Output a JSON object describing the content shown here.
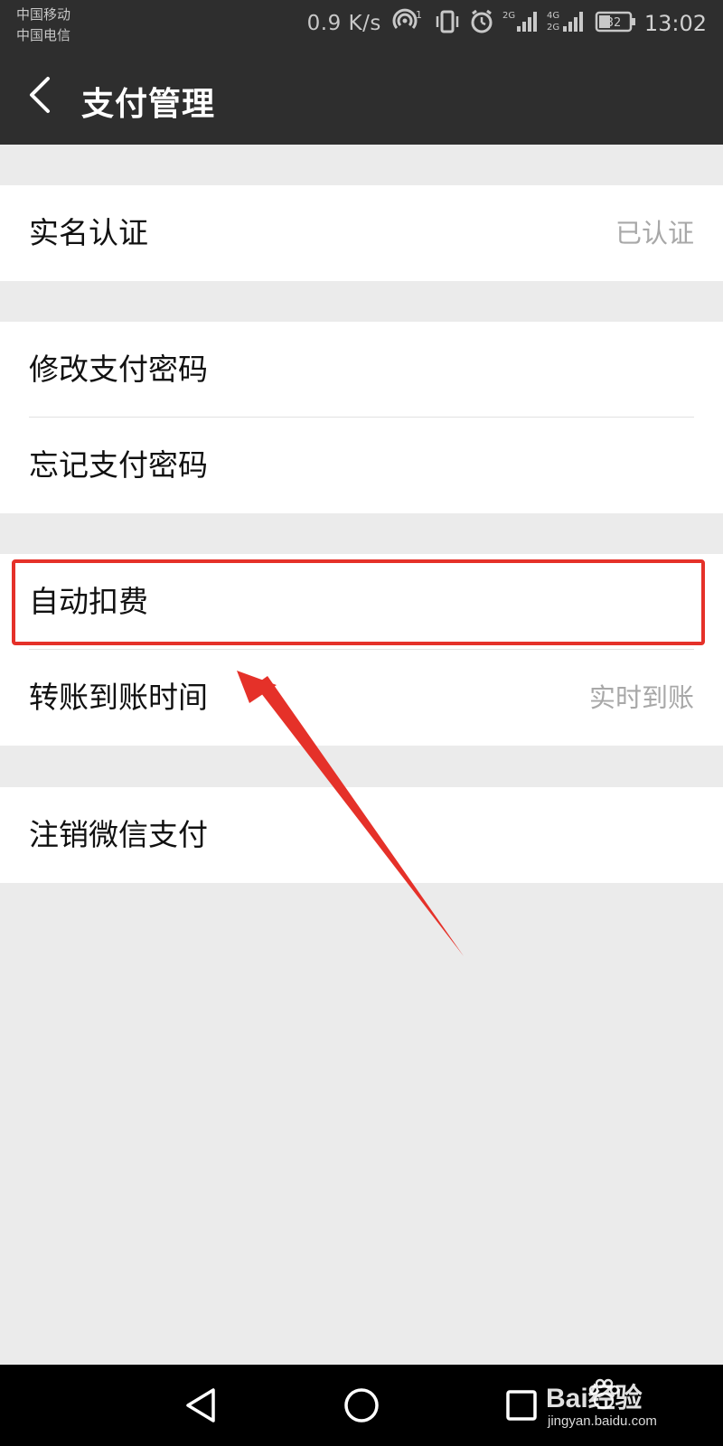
{
  "status_bar": {
    "carrier_1": "中国移动",
    "carrier_2": "中国电信",
    "net_speed": "0.9 K/s",
    "hotspot_badge": "1",
    "signal_label_1": "2G",
    "signal_label_2": "4G",
    "signal_label_3": "2G",
    "battery": "32",
    "time": "13:02"
  },
  "header": {
    "title": "支付管理",
    "back_icon": "chevron-left-icon"
  },
  "groups": [
    {
      "items": [
        {
          "label": "实名认证",
          "value": "已认证"
        }
      ]
    },
    {
      "items": [
        {
          "label": "修改支付密码",
          "value": ""
        },
        {
          "label": "忘记支付密码",
          "value": ""
        }
      ]
    },
    {
      "items": [
        {
          "label": "自动扣费",
          "value": ""
        },
        {
          "label": "转账到账时间",
          "value": "实时到账"
        }
      ]
    },
    {
      "items": [
        {
          "label": "注销微信支付",
          "value": ""
        }
      ]
    }
  ],
  "annotation": {
    "highlighted_item": "自动扣费",
    "highlight_color": "#e53129"
  },
  "nav_bar": {
    "back": "triangle-back-icon",
    "home": "circle-home-icon",
    "recents": "square-recents-icon"
  },
  "watermark": {
    "brand": "Bai经验",
    "url": "jingyan.baidu.com"
  },
  "colors": {
    "header_bg": "#2e2e2e",
    "page_bg": "#ebebeb",
    "cell_bg": "#ffffff",
    "secondary_text": "#a8a8a8"
  }
}
